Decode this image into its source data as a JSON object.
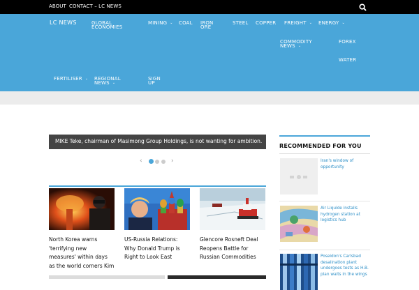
{
  "topbar": {
    "links": [
      "ABOUT",
      "CONTACT – LC NEWS"
    ],
    "search_icon": "search-icon"
  },
  "nav": {
    "logo": "LC NEWS",
    "items": [
      {
        "label": "GLOBAL ECONOMIES",
        "dropdown": false
      },
      {
        "label": "MINING",
        "dropdown": true
      },
      {
        "label": "COAL",
        "dropdown": false
      },
      {
        "label": "IRON ORE",
        "dropdown": false
      },
      {
        "label": "STEEL",
        "dropdown": false
      },
      {
        "label": "COPPER",
        "dropdown": false
      },
      {
        "label": "FREIGHT",
        "dropdown": true
      },
      {
        "label": "ENERGY",
        "dropdown": true
      },
      {
        "label": "COMMODITY NEWS",
        "dropdown": true
      },
      {
        "label": "FOREX",
        "dropdown": false
      },
      {
        "label": "WATER",
        "dropdown": false
      },
      {
        "label": "FERTILISER",
        "dropdown": true
      },
      {
        "label": "REGIONAL NEWS",
        "dropdown": true
      },
      {
        "label": "SIGN UP",
        "dropdown": false
      }
    ]
  },
  "slider": {
    "caption": "MIKE Teke, chairman of Masimong Group Holdings, is not wanting for ambition.",
    "prev": "‹",
    "next": "›",
    "slide_count": 3,
    "active_slide": 1
  },
  "cards": [
    {
      "title": "North Korea warns 'terrifying new measures' within days as the world corners Kim"
    },
    {
      "title": "US-Russia Relations: Why Donald Trump is Right to Look East"
    },
    {
      "title": "Glencore Rosneft Deal Reopens Battle for Russian Commodities"
    }
  ],
  "recommended": {
    "heading": "RECOMMENDED FOR YOU",
    "items": [
      {
        "title": "Iran's window of opportunity"
      },
      {
        "title": "Air Liquide installs hydrogen station at logistics hub"
      },
      {
        "title": "Poseidon's Carlsbad desalination plant undergoes tests as H.B. plan waits in the wings"
      }
    ]
  },
  "colors": {
    "accent": "#4aa6d9",
    "topbar": "#000000",
    "link": "#2d8fc7"
  }
}
